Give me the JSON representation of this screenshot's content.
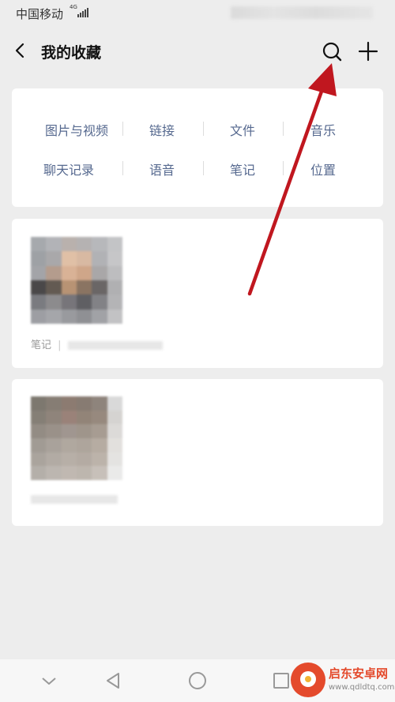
{
  "status_bar": {
    "carrier": "中国移动",
    "network": "4G"
  },
  "header": {
    "title": "我的收藏",
    "back_icon": "chevron-left-icon",
    "search_icon": "search-icon",
    "add_icon": "plus-icon"
  },
  "categories": [
    {
      "label": "图片与视频"
    },
    {
      "label": "链接"
    },
    {
      "label": "文件"
    },
    {
      "label": "音乐"
    },
    {
      "label": "聊天记录"
    },
    {
      "label": "语音"
    },
    {
      "label": "笔记"
    },
    {
      "label": "位置"
    }
  ],
  "favorites": [
    {
      "type_label": "笔记"
    },
    {
      "type_label": ""
    }
  ],
  "annotation": {
    "color": "#c0171f"
  },
  "system_nav": {
    "icons": [
      "chevron-down-icon",
      "back-triangle-icon",
      "home-circle-icon",
      "recent-square-icon"
    ]
  },
  "watermark": {
    "title": "启东安卓网",
    "url": "www.qdldtq.com"
  }
}
